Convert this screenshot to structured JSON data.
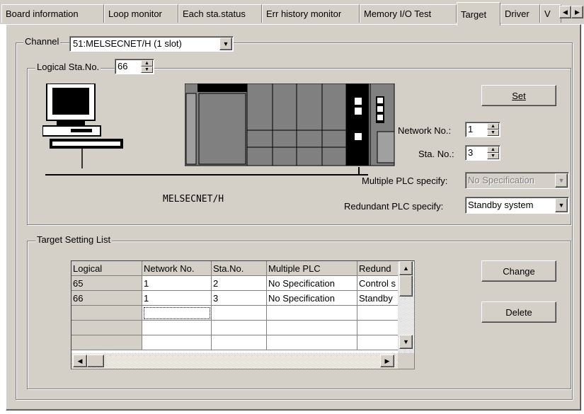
{
  "tabs": [
    {
      "label": "Board information",
      "active": false
    },
    {
      "label": "Loop monitor",
      "active": false
    },
    {
      "label": "Each sta.status",
      "active": false
    },
    {
      "label": "Err history monitor",
      "active": false
    },
    {
      "label": "Memory I/O Test",
      "active": false
    },
    {
      "label": "Target",
      "active": true
    },
    {
      "label": "Driver",
      "active": false
    },
    {
      "label": "V",
      "active": false
    }
  ],
  "channel": {
    "label": "Channel",
    "value": "51:MELSECNET/H (1 slot)"
  },
  "logical": {
    "label": "Logical Sta.No.",
    "value": "66"
  },
  "set_button": "Set",
  "network_no": {
    "label": "Network No.:",
    "value": "1"
  },
  "sta_no": {
    "label": "Sta. No.:",
    "value": "3"
  },
  "multiple_plc": {
    "label": "Multiple PLC specify:",
    "value": "No Specification",
    "disabled": true
  },
  "redundant_plc": {
    "label": "Redundant PLC specify:",
    "value": "Standby system"
  },
  "network_caption": "MELSECNET/H",
  "target_list": {
    "label": "Target Setting List",
    "headers": [
      "Logical",
      "Network No.",
      "Sta.No.",
      "Multiple PLC",
      "Redund"
    ],
    "rows": [
      [
        "65",
        "1",
        "2",
        "No Specification",
        "Control s"
      ],
      [
        "66",
        "1",
        "3",
        "No Specification",
        "Standby"
      ],
      [
        "",
        "",
        "",
        "",
        ""
      ],
      [
        "",
        "",
        "",
        "",
        ""
      ],
      [
        "",
        "",
        "",
        "",
        ""
      ]
    ]
  },
  "change_button": "Change",
  "delete_button": "Delete",
  "colors": {
    "face": "#d4d0c8",
    "shadow": "#808080",
    "highlight": "#ffffff"
  }
}
